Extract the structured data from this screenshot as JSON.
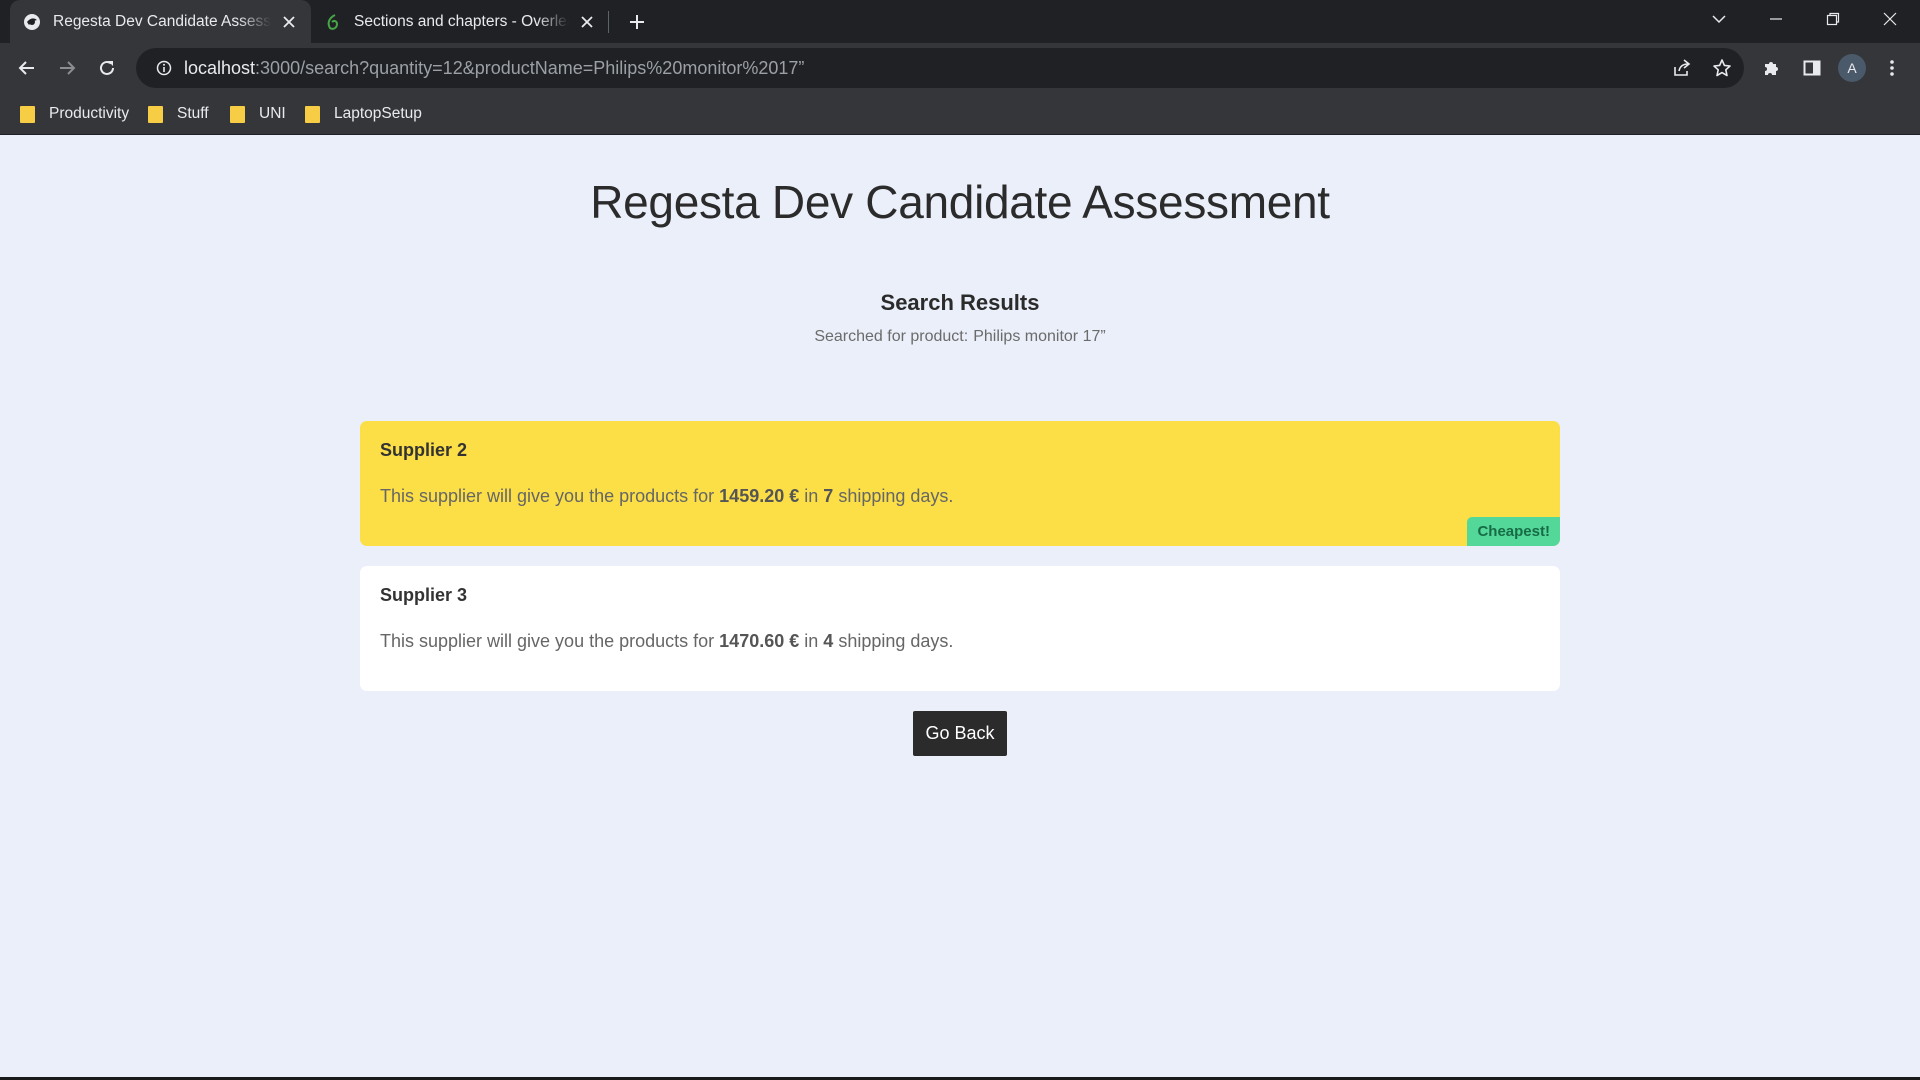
{
  "browser": {
    "tabs": [
      {
        "title": "Regesta Dev Candidate Assessment",
        "active": true
      },
      {
        "title": "Sections and chapters - Overleaf",
        "active": false
      }
    ],
    "address": {
      "host": "localhost",
      "path": ":3000/search?quantity=12&productName=Philips%20monitor%2017”"
    },
    "profile_initial": "A",
    "bookmarks": [
      "Productivity",
      "Stuff",
      "UNI",
      "LaptopSetup"
    ],
    "colors": {
      "frame": "#202124",
      "toolbar": "#35363a",
      "folder": "#f7cd46"
    }
  },
  "page": {
    "title": "Regesta Dev Candidate Assessment",
    "results_heading": "Search Results",
    "searched_prefix": "Searched for product:",
    "searched_product": "Philips monitor 17”",
    "offers": [
      {
        "supplier": "Supplier 2",
        "text_before": "This supplier will give you the products for",
        "price": "1459.20 €",
        "text_middle": "in",
        "days": "7",
        "text_after": "shipping days.",
        "badge": "Cheapest!",
        "highlight_color": "#fcdf46"
      },
      {
        "supplier": "Supplier 3",
        "text_before": "This supplier will give you the products for",
        "price": "1470.60 €",
        "text_middle": "in",
        "days": "4",
        "text_after": "shipping days.",
        "badge": "",
        "highlight_color": "#ffffff"
      }
    ],
    "go_back_label": "Go Back",
    "colors": {
      "background": "#eaeff9",
      "badge": "#53d89a",
      "button": "#2b2b2b"
    }
  }
}
